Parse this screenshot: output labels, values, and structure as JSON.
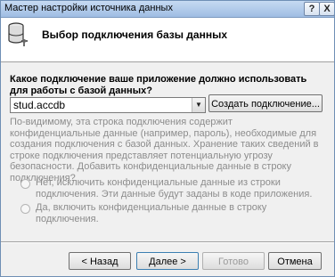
{
  "window": {
    "title": "Мастер настройки источника данных",
    "help_label": "?",
    "close_label": "X"
  },
  "header": {
    "title": "Выбор подключения базы данных"
  },
  "question": "Какое подключение ваше приложение должно использовать для работы с базой данных?",
  "connection": {
    "selected": "stud.accdb",
    "new_button": "Создать подключение..."
  },
  "info_text": "По-видимому, эта строка подключения содержит конфиденциальные данные (например, пароль), необходимые для создания подключения с базой данных. Хранение таких сведений в строке подключения представляет потенциальную угрозу безопасности. Добавить конфиденциальные данные в строку подключения?",
  "options": [
    {
      "label": "Нет, исключить конфиденциальные данные из строки подключения. Эти данные будут заданы в коде приложения."
    },
    {
      "label": "Да, включить конфиденциальные данные в строку подключения."
    }
  ],
  "footer": {
    "back": "< Назад",
    "next": "Далее >",
    "finish": "Готово",
    "cancel": "Отмена"
  },
  "icons": {
    "header": "database-icon",
    "combo": "chevron-down-icon"
  }
}
